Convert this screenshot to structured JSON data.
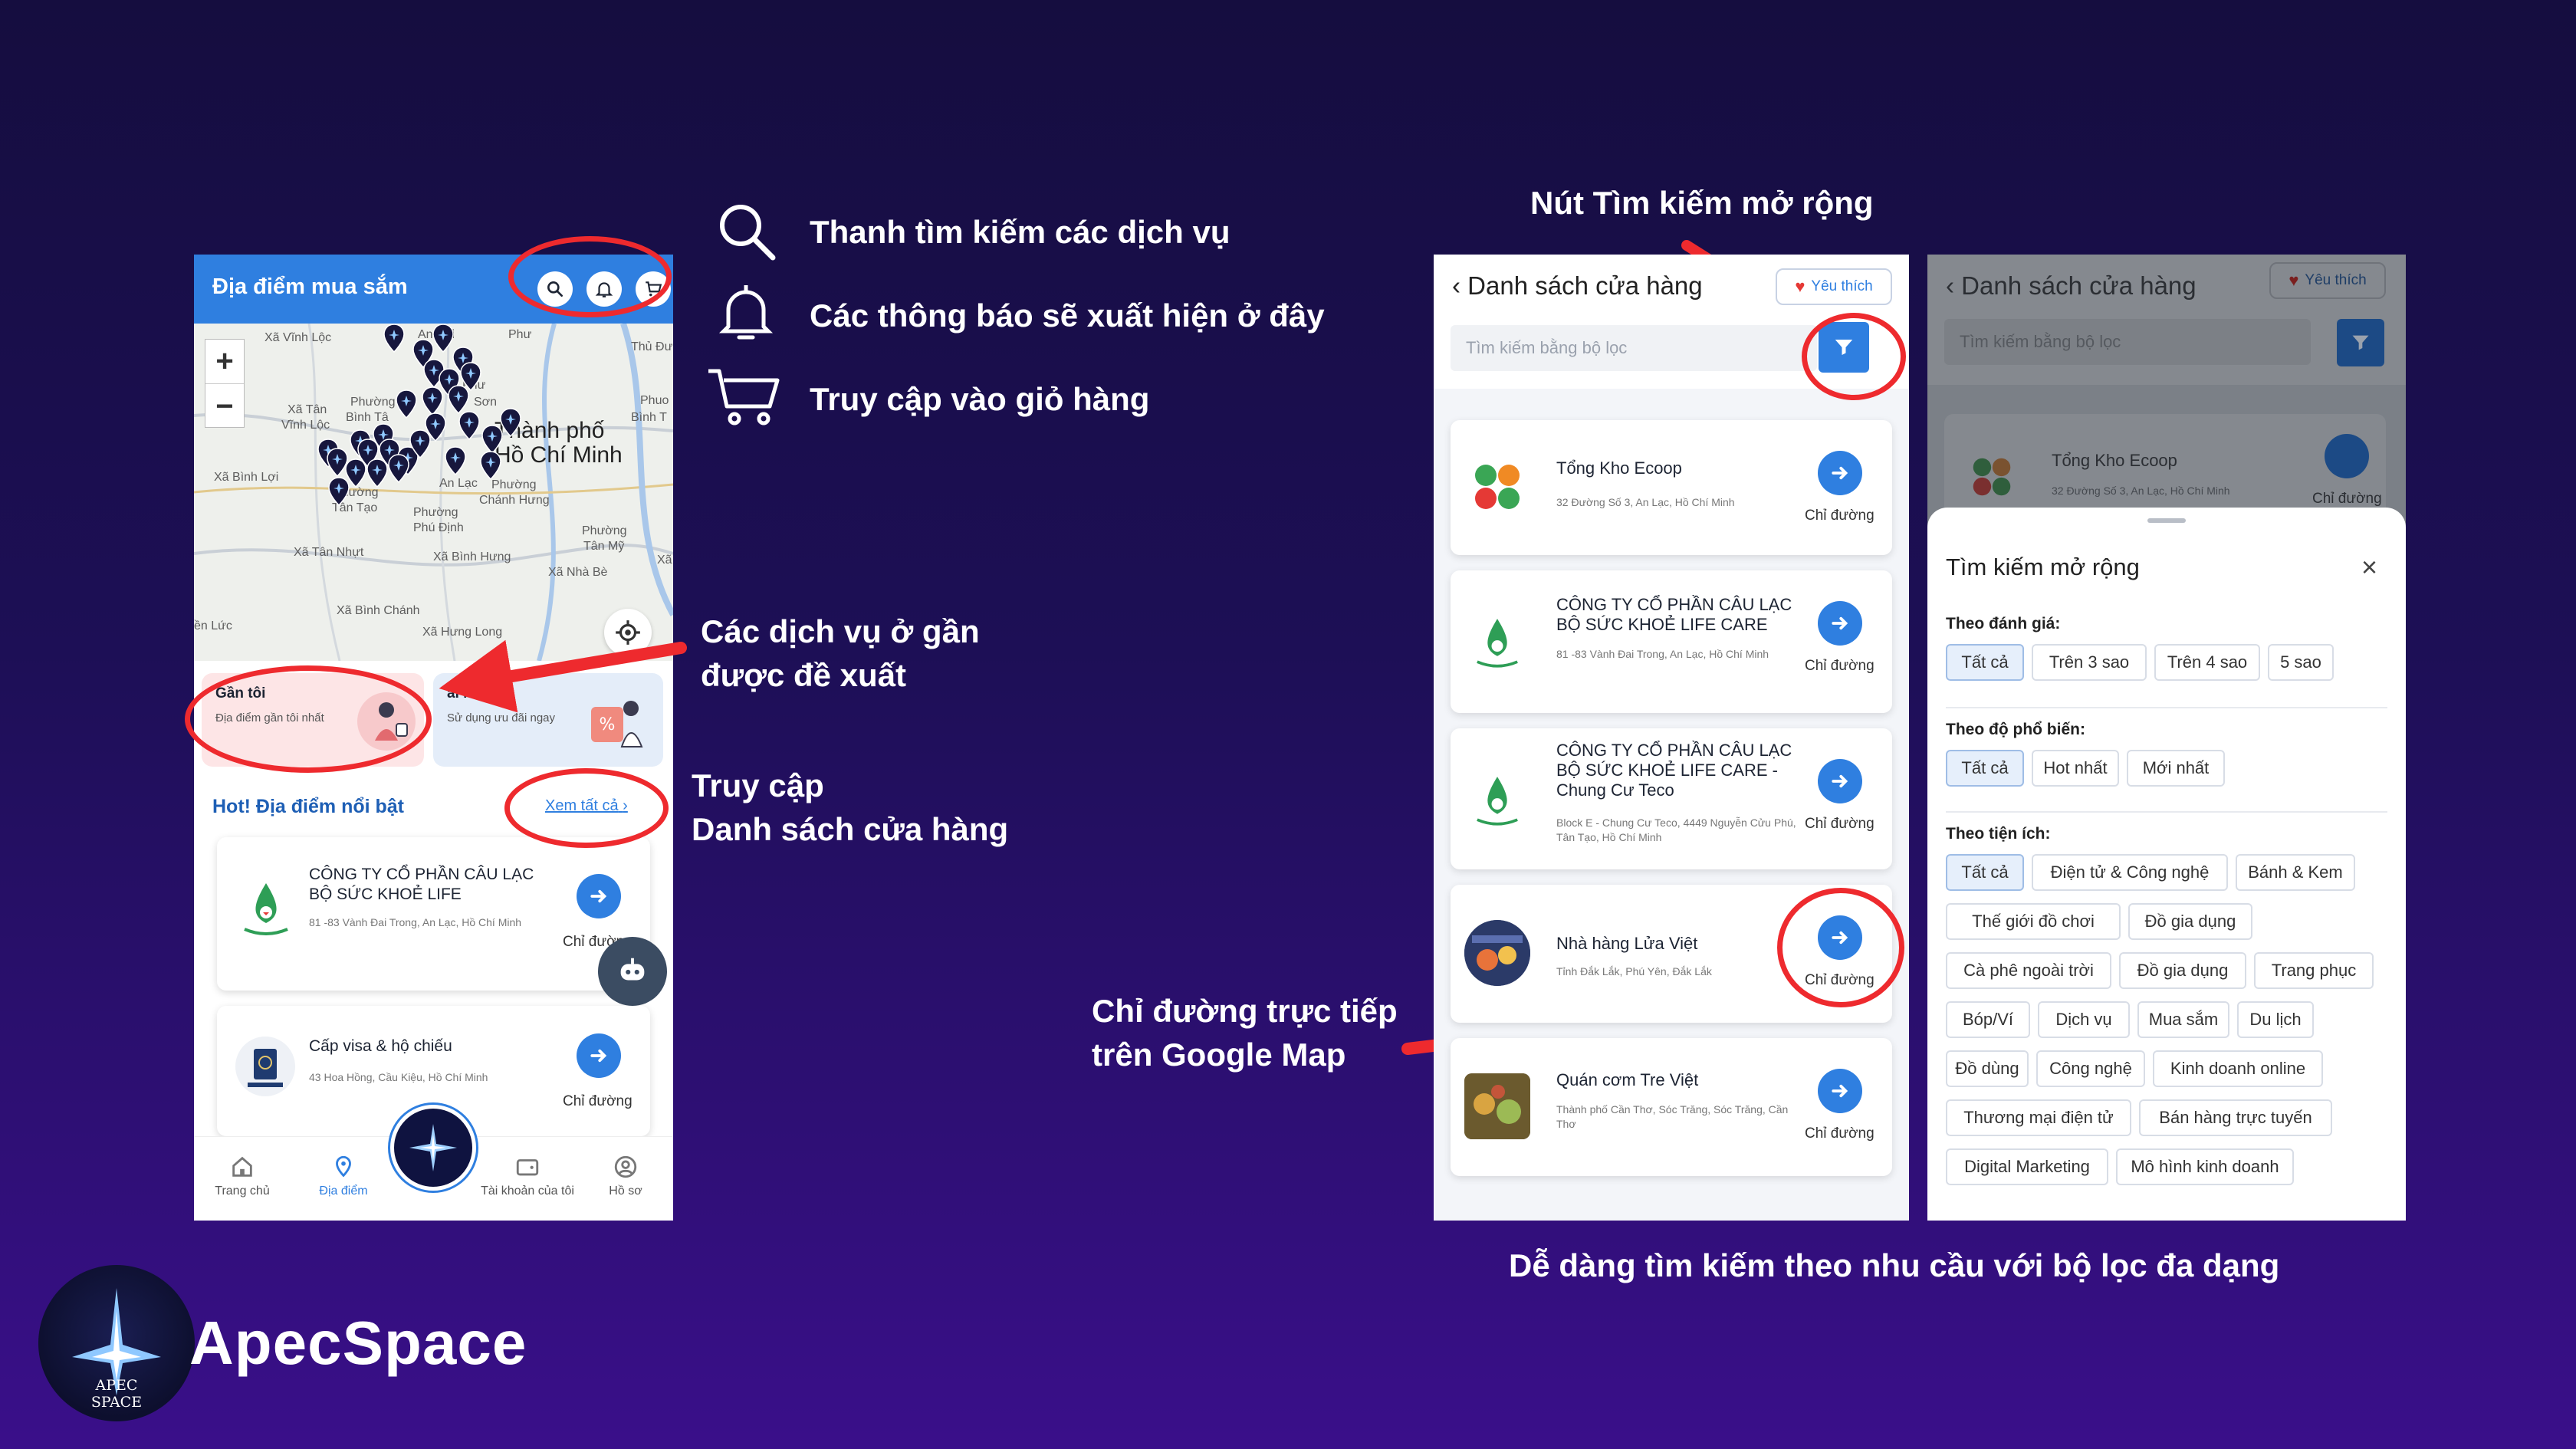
{
  "annotations": {
    "search": "Thanh tìm kiếm các dịch vụ",
    "notify": "Các thông báo sẽ xuất hiện ở đây",
    "cart": "Truy cập vào giỏ hàng",
    "nearby_l1": "Các dịch vụ ở gần",
    "nearby_l2": "được đề xuất",
    "list_l1": "Truy cập",
    "list_l2": "Danh sách cửa hàng",
    "directions_l1": "Chỉ đường trực tiếp",
    "directions_l2": "trên Google Map",
    "expanded_search": "Nút Tìm kiếm mở rộng",
    "filter_caption": "Dễ dàng tìm kiếm theo nhu cầu với bộ lọc đa dạng"
  },
  "brand": {
    "name": "ApecSpace",
    "logo_text": "APEC SPACE"
  },
  "phone1": {
    "header_title": "Địa điểm mua sắm",
    "header_icons": [
      "search-icon",
      "bell-icon",
      "cart-icon"
    ],
    "map_labels": {
      "vinh_loc": "Xã Vĩnh Lộc",
      "an_hoi": "An Hội",
      "phu1": "Phư",
      "thu_du": "Thủ Đư",
      "phu2": "Phư",
      "son": "Sơn",
      "phuo": "Phuo",
      "binh_t": "Bình T",
      "xa_tan": "Xã Tân",
      "vinh_loc2": "Vĩnh Lộc",
      "phuong": "Phường",
      "binh_ta": "Bình Tâ",
      "city1": "Thành phố",
      "city2": "Hồ Chí Minh",
      "binh_loi": "Xã Bình Lợi",
      "an_lam": "An Lạc",
      "phuong_chanh": "Phường",
      "chanh_hung": "Chánh Hưng",
      "phuong_tt": "Phường",
      "tan_tao": "Tân Tạo",
      "phuong_pd": "Phường",
      "phu_dinh": "Phú Định",
      "phuong_tm": "Phường",
      "tan_my": "Tân Mỹ",
      "tan_nhut": "Xã Tân Nhựt",
      "binh_hung": "Xã Bình Hưng",
      "nha_be": "Xã Nhà Bè",
      "binh_chanh": "Xã Bình Chánh",
      "hung_long": "Xã Hưng Long",
      "en_luc": "ền Lức",
      "xa": "Xã"
    },
    "zoom_in": "+",
    "zoom_out": "−",
    "nearby_card": {
      "title": "Gần tôi",
      "subtitle": "Địa điểm gần tôi nhất"
    },
    "hot_card": {
      "title": "ai hot",
      "subtitle": "Sử dụng ưu đãi ngay"
    },
    "section_title": "Hot! Địa điểm nổi bật",
    "see_all": "Xem tất cả",
    "stores": [
      {
        "name": "CÔNG TY CỔ PHẦN CÂU LẠC BỘ SỨC KHOẺ LIFE",
        "address": "81 -83 Vành Đai Trong, An Lạc, Hồ Chí Minh",
        "action": "Chỉ đường"
      },
      {
        "name": "Cấp visa & hộ chiếu",
        "address": "43 Hoa Hồng, Cầu Kiệu, Hồ Chí Minh",
        "action": "Chỉ đường"
      }
    ],
    "tabs": [
      "Trang chủ",
      "Địa điểm",
      "Tài khoản của tôi",
      "Hồ sơ"
    ]
  },
  "phone2": {
    "title": "Danh sách cửa hàng",
    "favorite": "Yêu thích",
    "search_placeholder": "Tìm kiếm bằng bộ lọc",
    "stores": [
      {
        "name": "Tổng Kho Ecoop",
        "address": "32 Đường Số 3, An Lạc, Hồ Chí Minh",
        "action": "Chỉ đường"
      },
      {
        "name": "CÔNG TY CỔ PHẦN CÂU LẠC BỘ SỨC KHOẺ LIFE CARE",
        "address": "81 -83 Vành Đai Trong, An Lạc, Hồ Chí Minh",
        "action": "Chỉ đường"
      },
      {
        "name": "CÔNG TY CỔ PHẦN CÂU LẠC BỘ SỨC KHOẺ LIFE CARE - Chung Cư Teco",
        "address": "Block E - Chung Cư Teco, 4449 Nguyễn Cửu Phú, Tân Tạo, Hồ Chí Minh",
        "action": "Chỉ đường"
      },
      {
        "name": "Nhà hàng Lửa Việt",
        "address": "Tỉnh Đắk Lắk, Phú Yên, Đắk Lắk",
        "action": "Chỉ đường"
      },
      {
        "name": "Quán cơm Tre Việt",
        "address": "Thành phố Cần Thơ, Sóc Trăng, Sóc Trăng, Cần Thơ",
        "action": "Chỉ đường"
      }
    ]
  },
  "phone3": {
    "title": "Danh sách cửa hàng",
    "favorite": "Yêu thích",
    "search_placeholder": "Tìm kiếm bằng bộ lọc",
    "bg_store": {
      "name": "Tổng Kho Ecoop",
      "address": "32 Đường Số 3, An Lạc, Hồ Chí Minh",
      "action": "Chỉ đường"
    },
    "sheet_title": "Tìm kiếm mở rộng",
    "rating_label": "Theo đánh giá:",
    "rating_options": [
      "Tất cả",
      "Trên 3 sao",
      "Trên 4 sao",
      "5 sao"
    ],
    "popularity_label": "Theo độ phổ biến:",
    "popularity_options": [
      "Tất cả",
      "Hot nhất",
      "Mới nhất"
    ],
    "amenity_label": "Theo tiện ích:",
    "amenity_options": [
      "Tất cả",
      "Điện tử & Công nghệ",
      "Bánh & Kem",
      "Thế giới đồ chơi",
      "Đồ gia dụng",
      "Cà phê ngoài trời",
      "Đồ gia dụng",
      "Trang phục",
      "Bóp/Ví",
      "Dịch vụ",
      "Mua sắm",
      "Du lịch",
      "Đồ dùng",
      "Công nghệ",
      "Kinh doanh online",
      "Thương mại điện tử",
      "Bán hàng trực tuyến",
      "Digital Marketing",
      "Mô hình kinh doanh"
    ]
  },
  "colors": {
    "accent": "#2f7fe0",
    "highlight_ring": "#ee2a2e",
    "heart": "#e53935"
  }
}
